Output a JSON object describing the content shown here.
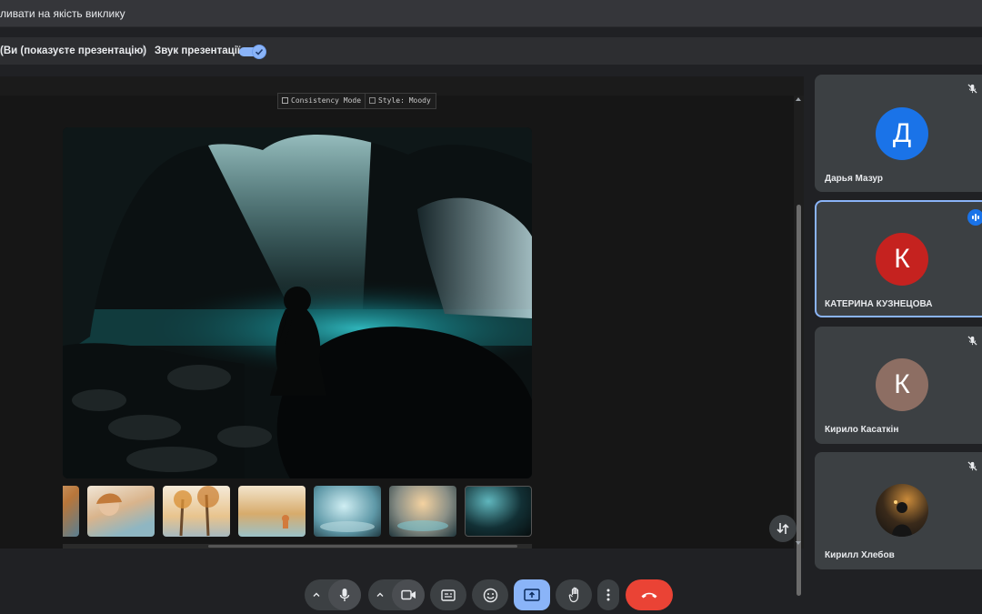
{
  "banner": {
    "text": "ливати на якість виклику"
  },
  "presentation": {
    "presenter_label": "(Ви (показуєте презентацію)",
    "audio_label": "Звук презентації",
    "audio_enabled": true
  },
  "shared_screen": {
    "chips": [
      "Consistency Mode",
      "Style: Moody"
    ],
    "thumbnail_count": 6
  },
  "participants": [
    {
      "initial": "Д",
      "name": "Дарья Мазур",
      "color": "#1a73e8",
      "muted": true,
      "speaking": false
    },
    {
      "initial": "К",
      "name": "КАТЕРИНА КУЗНЕЦОВА",
      "color": "#c5221f",
      "muted": false,
      "speaking": true
    },
    {
      "initial": "К",
      "name": "Кирило Касаткін",
      "color": "#8d6e63",
      "muted": true,
      "speaking": false
    },
    {
      "initial": "",
      "name": "Кирилл Хлебов",
      "color": "#5f6368",
      "muted": true,
      "speaking": false
    }
  ],
  "controls": {
    "mic": "mic-icon",
    "camera": "videocam-icon",
    "captions": "closed-caption-icon",
    "reactions": "emoji-icon",
    "present": "present-screen-icon",
    "raise_hand": "hand-icon",
    "more": "more-vert-icon",
    "leave": "call-end-icon"
  },
  "colors": {
    "accent": "#8ab4f8",
    "end_call": "#ea4335",
    "background": "#202124"
  }
}
